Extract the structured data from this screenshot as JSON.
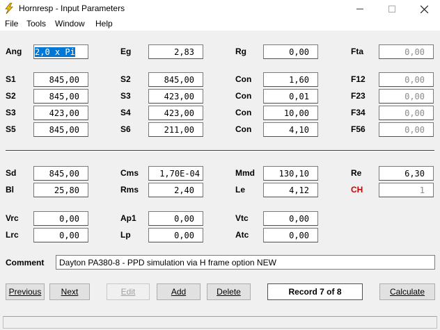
{
  "window": {
    "title": "Hornresp - Input Parameters"
  },
  "menu": [
    "File",
    "Tools",
    "Window",
    "Help"
  ],
  "row_ang": {
    "ang_label": "Ang",
    "ang_value": "2,0 x Pi",
    "eg_label": "Eg",
    "eg_value": "2,83",
    "rg_label": "Rg",
    "rg_value": "0,00",
    "fta_label": "Fta",
    "fta_value": "0,00"
  },
  "horn": {
    "s_labels": [
      "S1",
      "S2",
      "S3",
      "S5"
    ],
    "s_values": [
      "845,00",
      "845,00",
      "423,00",
      "845,00"
    ],
    "s2_labels": [
      "S2",
      "S3",
      "S4",
      "S6"
    ],
    "s2_values": [
      "845,00",
      "423,00",
      "423,00",
      "211,00"
    ],
    "con_labels": [
      "Con",
      "Con",
      "Con",
      "Con"
    ],
    "con_values": [
      "1,60",
      "0,01",
      "10,00",
      "4,10"
    ],
    "f_labels": [
      "F12",
      "F23",
      "F34",
      "F56"
    ],
    "f_values": [
      "0,00",
      "0,00",
      "0,00",
      "0,00"
    ]
  },
  "driver": {
    "sd_label": "Sd",
    "sd_value": "845,00",
    "cms_label": "Cms",
    "cms_value": "1,70E-04",
    "mmd_label": "Mmd",
    "mmd_value": "130,10",
    "re_label": "Re",
    "re_value": "6,30",
    "bl_label": "Bl",
    "bl_value": "25,80",
    "rms_label": "Rms",
    "rms_value": "2,40",
    "le_label": "Le",
    "le_value": "4,12",
    "ch_label": "CH",
    "ch_value": "1"
  },
  "chamber": {
    "vrc_label": "Vrc",
    "vrc_value": "0,00",
    "ap1_label": "Ap1",
    "ap1_value": "0,00",
    "vtc_label": "Vtc",
    "vtc_value": "0,00",
    "lrc_label": "Lrc",
    "lrc_value": "0,00",
    "lp_label": "Lp",
    "lp_value": "0,00",
    "atc_label": "Atc",
    "atc_value": "0,00"
  },
  "comment": {
    "label": "Comment",
    "value": "Dayton PA380-8 - PPD simulation via H frame option NEW"
  },
  "buttons": {
    "previous": "Previous",
    "next": "Next",
    "edit": "Edit",
    "add": "Add",
    "delete": "Delete",
    "record": "Record 7 of 8",
    "calculate": "Calculate"
  },
  "icons": {
    "app": "lightning-icon",
    "minimize": "minimize-icon",
    "maximize": "maximize-icon",
    "close": "close-icon"
  },
  "colors": {
    "selection": "#0078d7",
    "ch_label": "#d00000",
    "app_icon": "#f2c40f"
  }
}
